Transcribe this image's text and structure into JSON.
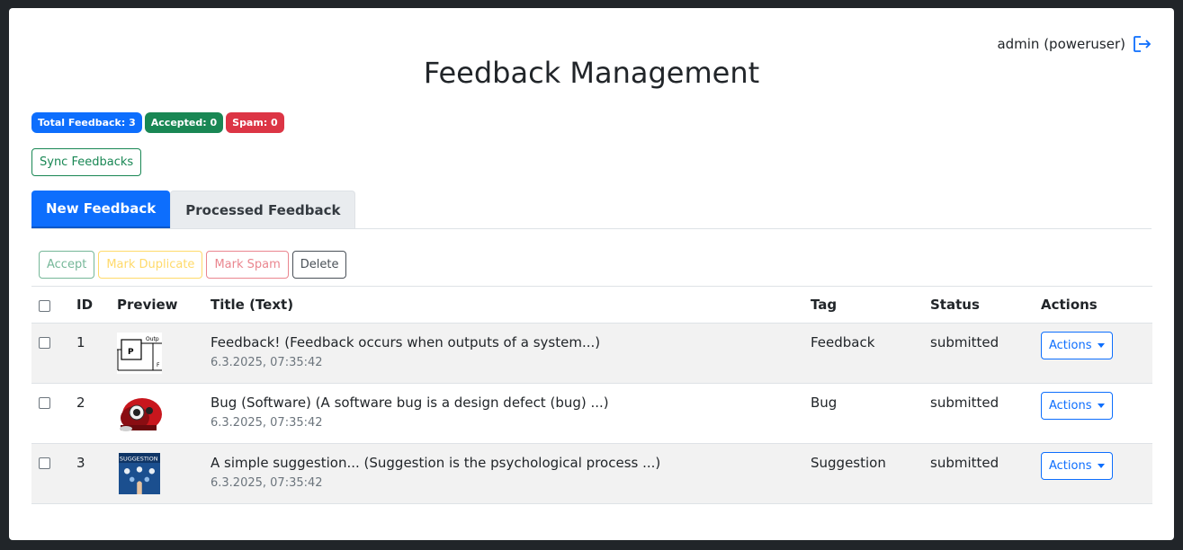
{
  "user": {
    "label": "admin (poweruser)"
  },
  "page": {
    "title": "Feedback Management"
  },
  "badges": {
    "total": "Total Feedback: 3",
    "accepted": "Accepted: 0",
    "spam": "Spam: 0"
  },
  "sync_button": "Sync Feedbacks",
  "tabs": [
    {
      "label": "New Feedback",
      "active": true
    },
    {
      "label": "Processed Feedback",
      "active": false
    }
  ],
  "bulk_actions": {
    "accept": "Accept",
    "mark_duplicate": "Mark Duplicate",
    "mark_spam": "Mark Spam",
    "delete": "Delete"
  },
  "table": {
    "headers": {
      "id": "ID",
      "preview": "Preview",
      "title": "Title (Text)",
      "tag": "Tag",
      "status": "Status",
      "actions": "Actions"
    },
    "rows": [
      {
        "id": "1",
        "title": "Feedback! (Feedback occurs when outputs of a system...)",
        "date": "6.3.2025, 07:35:42",
        "tag": "Feedback",
        "status": "submitted",
        "action_label": "Actions"
      },
      {
        "id": "2",
        "title": "Bug (Software) (A software bug is a design defect (bug) ...)",
        "date": "6.3.2025, 07:35:42",
        "tag": "Bug",
        "status": "submitted",
        "action_label": "Actions"
      },
      {
        "id": "3",
        "title": "A simple suggestion... (Suggestion is the psychological process ...)",
        "date": "6.3.2025, 07:35:42",
        "tag": "Suggestion",
        "status": "submitted",
        "action_label": "Actions"
      }
    ]
  },
  "thumbnails": {
    "row1_text_outp": "Outp",
    "row1_text_p": "P",
    "row1_text_f": "F",
    "row3_text": "SUGGESTION"
  },
  "colors": {
    "primary": "#0d6efd",
    "success": "#198754",
    "danger": "#dc3545"
  }
}
